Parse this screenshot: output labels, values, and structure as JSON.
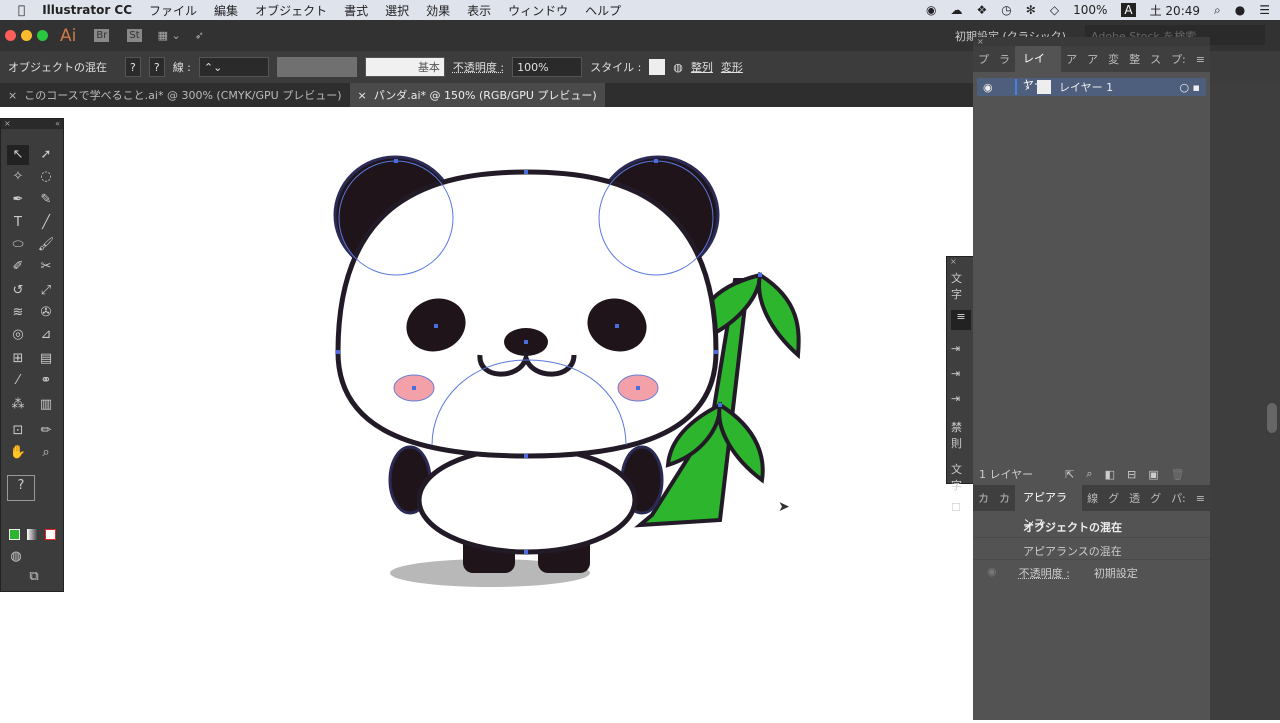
{
  "menubar": {
    "app": "Illustrator CC",
    "items": [
      "ファイル",
      "編集",
      "オブジェクト",
      "書式",
      "選択",
      "効果",
      "表示",
      "ウィンドウ",
      "ヘルプ"
    ],
    "battery": "100%",
    "clock": "土 20:49"
  },
  "appbar": {
    "logo": "Ai",
    "br": "Br",
    "st": "St",
    "workspace": "初期設定 (クラシック)",
    "search_placeholder": "Adobe Stock を検索"
  },
  "control": {
    "label": "オブジェクトの混在",
    "fill": "?",
    "stroke": "?",
    "stroke_label": "線 :",
    "brush": "基本",
    "opacity_label": "不透明度 :",
    "opacity": "100%",
    "style_label": "スタイル :",
    "align": "整列",
    "transform": "変形"
  },
  "tabs": [
    {
      "label": "このコースで学べること.ai* @ 300% (CMYK/GPU プレビュー)"
    },
    {
      "label": "パンダ.ai* @ 150% (RGB/GPU プレビュー)"
    }
  ],
  "layers": {
    "tabs": [
      "プ",
      "ラ",
      "レイヤー",
      "ア",
      "ア",
      "変",
      "整",
      "ス",
      "プ:"
    ],
    "items": [
      {
        "name": "レイヤー 1"
      }
    ],
    "count": "1 レイヤー"
  },
  "textpanel": {
    "title": "文字",
    "labels": [
      "禁則",
      "文字"
    ]
  },
  "appearance": {
    "tabs": [
      "カ",
      "カ",
      "アピアランス",
      "線",
      "グ",
      "透",
      "グ",
      "パ:"
    ],
    "title": "オブジェクトの混在",
    "mixed": "アピアランスの混在",
    "opacity_label": "不透明度 :",
    "opacity_value": "初期設定"
  },
  "colors": {
    "accent": "#4a7ee0",
    "leaf": "#2db52d",
    "cheek": "#f4a0a8",
    "outline": "#231a28"
  }
}
